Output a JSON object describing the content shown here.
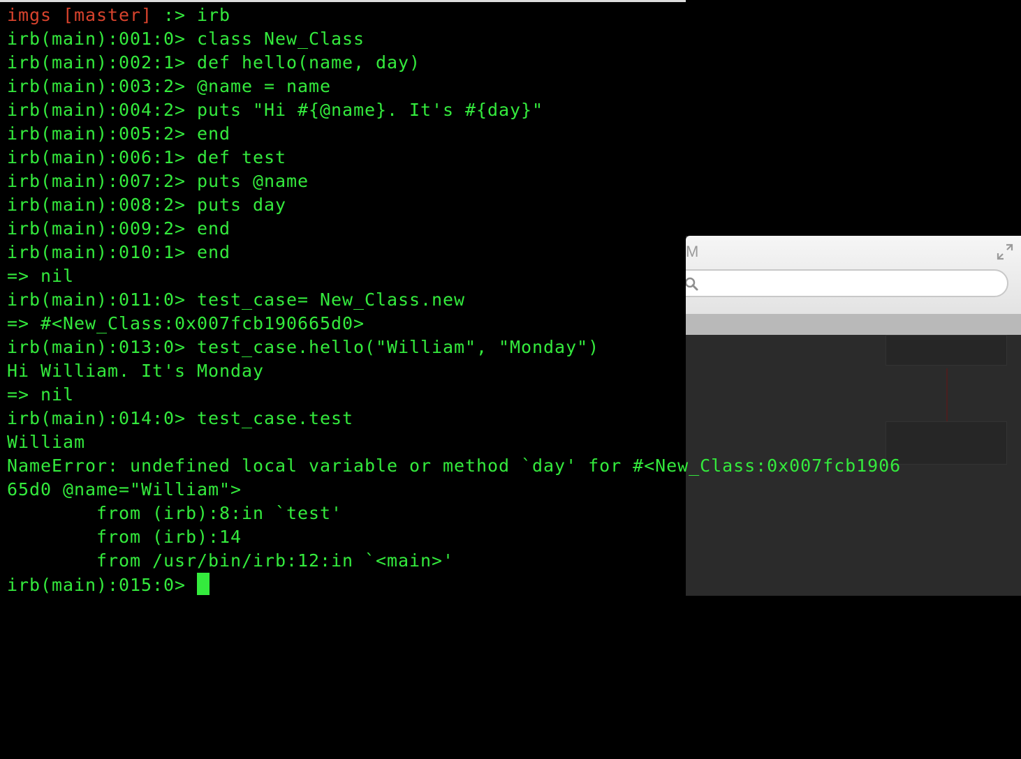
{
  "background_window": {
    "title_fragment": "M",
    "search_placeholder": "",
    "icons": [
      "expand-icon",
      "search-icon"
    ]
  },
  "terminal": {
    "colors": {
      "background": "#000000",
      "text": "#34ea3d",
      "prompt_path": "#d8432d",
      "cursor": "#34ea3d"
    },
    "shell_prompt": {
      "path_text": "imgs [master]",
      "symbol": " :> ",
      "command": "irb"
    },
    "lines": [
      "irb(main):001:0> class New_Class",
      "irb(main):002:1> def hello(name, day)",
      "irb(main):003:2> @name = name",
      "irb(main):004:2> puts \"Hi #{@name}. It's #{day}\"",
      "irb(main):005:2> end",
      "irb(main):006:1> def test",
      "irb(main):007:2> puts @name",
      "irb(main):008:2> puts day",
      "irb(main):009:2> end",
      "irb(main):010:1> end",
      "=> nil",
      "irb(main):011:0> test_case= New_Class.new",
      "=> #<New_Class:0x007fcb190665d0>",
      "irb(main):013:0> test_case.hello(\"William\", \"Monday\")",
      "Hi William. It's Monday",
      "=> nil",
      "irb(main):014:0> test_case.test",
      "William",
      "NameError: undefined local variable or method `day' for #<New_Class:0x007fcb1906",
      "65d0 @name=\"William\">",
      "        from (irb):8:in `test'",
      "        from (irb):14",
      "        from /usr/bin/irb:12:in `<main>'"
    ],
    "current_prompt": "irb(main):015:0> "
  }
}
